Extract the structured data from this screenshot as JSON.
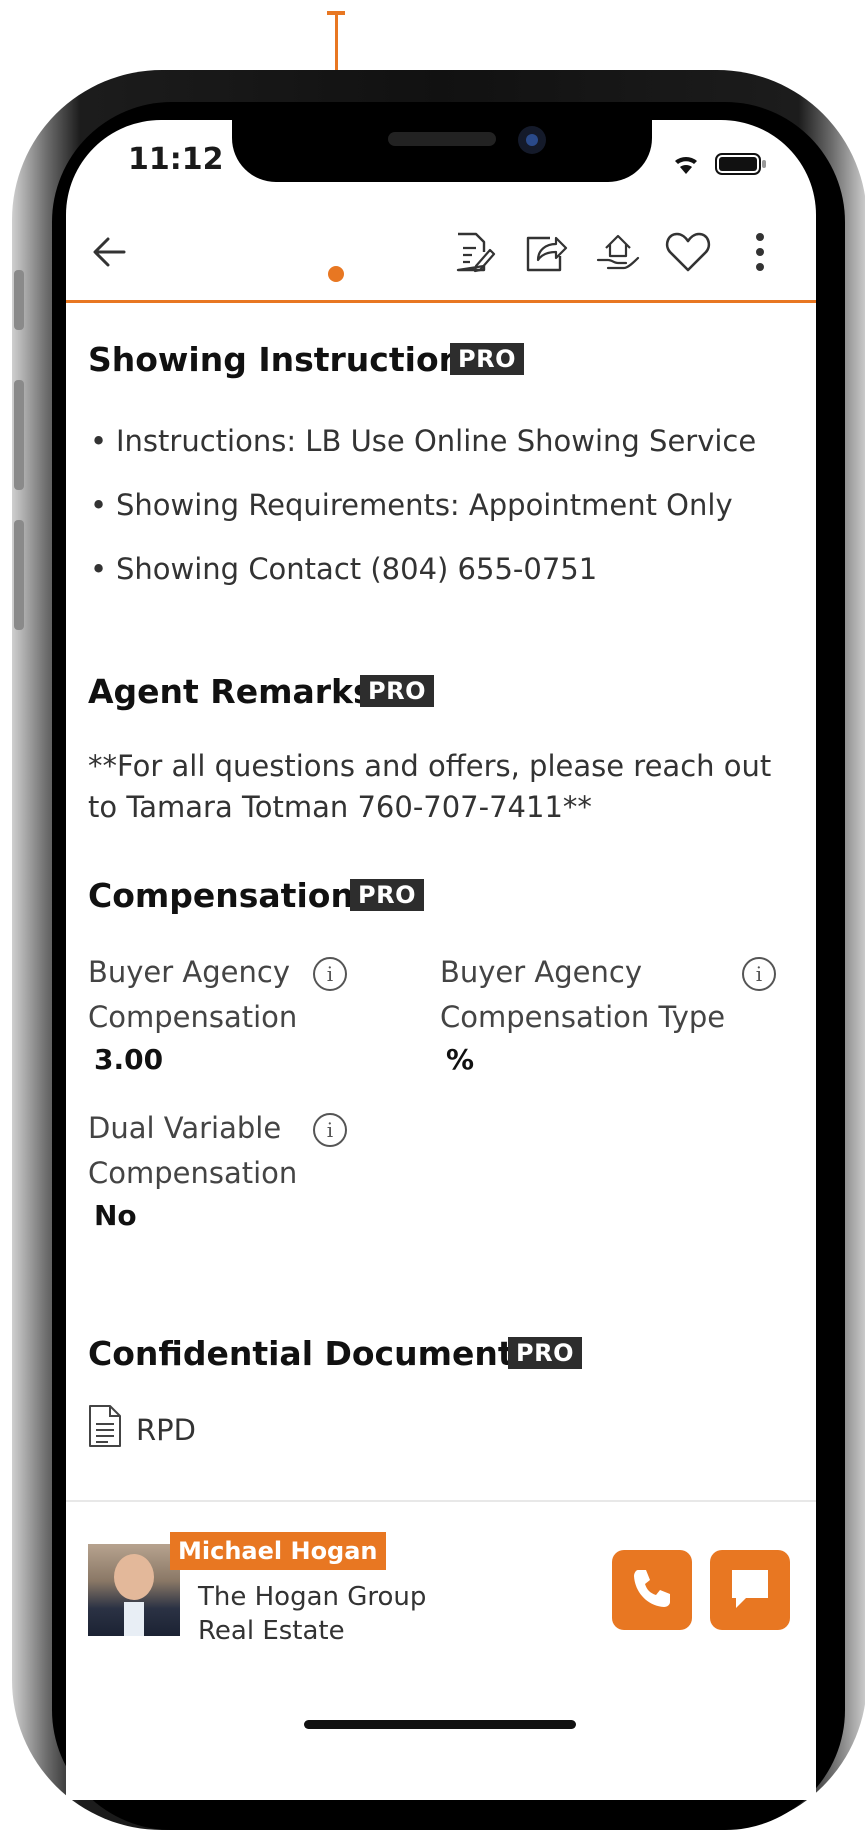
{
  "status_bar": {
    "time": "11:12"
  },
  "appbar": {
    "icons": [
      "back-arrow-icon",
      "edit-document-icon",
      "share-icon",
      "home-offer-icon",
      "heart-icon",
      "more-vertical-icon"
    ]
  },
  "accent_color": "#e87722",
  "showing_instructions": {
    "title": "Showing Instructions",
    "badge": "PRO",
    "items": [
      "Instructions: LB Use Online Showing Service",
      "Showing Requirements: Appointment Only",
      "Showing Contact (804) 655-0751"
    ]
  },
  "agent_remarks": {
    "title": "Agent Remarks",
    "badge": "PRO",
    "text": "**For all questions and offers, please reach out to Tamara Totman 760-707-7411**"
  },
  "compensation": {
    "title": "Compensation",
    "badge": "PRO",
    "fields": [
      {
        "label_line1": "Buyer Agency",
        "label_line2": "Compensation",
        "value": "3.00"
      },
      {
        "label_line1": "Buyer Agency",
        "label_line2": "Compensation Type",
        "value": "%"
      },
      {
        "label_line1": "Dual Variable",
        "label_line2": "Compensation",
        "value": "No"
      }
    ]
  },
  "confidential_documents": {
    "title": "Confidential Documents",
    "badge": "PRO",
    "documents": [
      "RPD"
    ]
  },
  "agent": {
    "name": "Michael Hogan",
    "company_line1": "The Hogan Group",
    "company_line2": "Real Estate"
  }
}
